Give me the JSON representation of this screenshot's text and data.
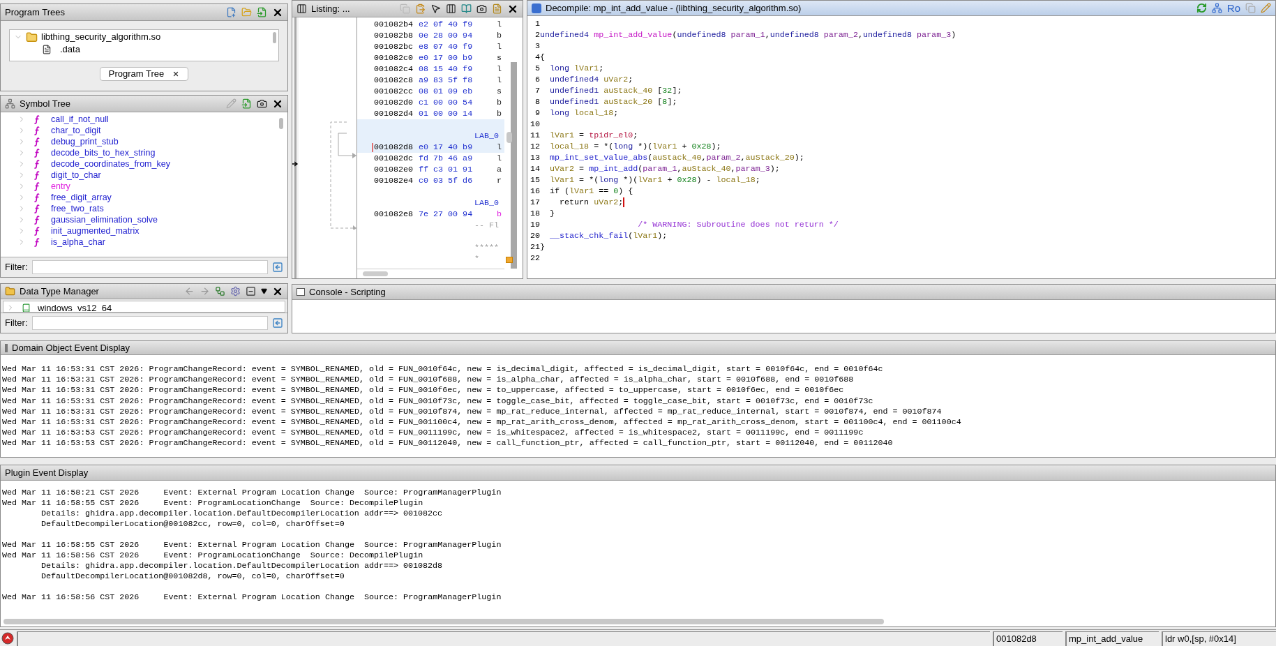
{
  "program_trees": {
    "title": "Program Trees",
    "root": {
      "label": "libthing_security_algorithm.so",
      "expanded": true,
      "children": [
        {
          "label": ".data"
        }
      ]
    },
    "tab": {
      "label": "Program Tree"
    }
  },
  "symbol_tree": {
    "title": "Symbol Tree",
    "items": [
      {
        "label": "call_if_not_null",
        "expanded": false,
        "color": "#2020d0"
      },
      {
        "label": "char_to_digit",
        "expanded": false,
        "color": "#2020d0"
      },
      {
        "label": "debug_print_stub",
        "expanded": false,
        "color": "#2020d0"
      },
      {
        "label": "decode_bits_to_hex_string",
        "expanded": false,
        "color": "#2020d0"
      },
      {
        "label": "decode_coordinates_from_key",
        "expanded": false,
        "color": "#2020d0"
      },
      {
        "label": "digit_to_char",
        "expanded": false,
        "color": "#2020d0"
      },
      {
        "label": "entry",
        "expanded": false,
        "color": "#e020e0"
      },
      {
        "label": "free_digit_array",
        "expanded": false,
        "color": "#2020d0"
      },
      {
        "label": "free_two_rats",
        "expanded": false,
        "color": "#2020d0"
      },
      {
        "label": "gaussian_elimination_solve",
        "expanded": false,
        "color": "#2020d0"
      },
      {
        "label": "init_augmented_matrix",
        "expanded": false,
        "color": "#2020d0"
      },
      {
        "label": "is_alpha_char",
        "expanded": false,
        "color": "#2020d0"
      }
    ],
    "filter_label": "Filter:"
  },
  "data_type_manager": {
    "title": "Data Type Manager",
    "items": [
      {
        "label": "windows_vs12_64",
        "expanded": false
      }
    ],
    "filter_label": "Filter:"
  },
  "listing": {
    "title": "Listing: ...",
    "rows": [
      {
        "kind": "code",
        "address": "001082b4",
        "bytes": "e2 0f 40 f9",
        "mnemonic": "l",
        "is_call": false,
        "highlighted": false,
        "cursor": false
      },
      {
        "kind": "code",
        "address": "001082b8",
        "bytes": "0e 28 00 94",
        "mnemonic": "b",
        "is_call": false,
        "highlighted": false,
        "cursor": false
      },
      {
        "kind": "code",
        "address": "001082bc",
        "bytes": "e8 07 40 f9",
        "mnemonic": "l",
        "is_call": false,
        "highlighted": false,
        "cursor": false
      },
      {
        "kind": "code",
        "address": "001082c0",
        "bytes": "e0 17 00 b9",
        "mnemonic": "s",
        "is_call": false,
        "highlighted": false,
        "cursor": false
      },
      {
        "kind": "code",
        "address": "001082c4",
        "bytes": "08 15 40 f9",
        "mnemonic": "l",
        "is_call": false,
        "highlighted": false,
        "cursor": false
      },
      {
        "kind": "code",
        "address": "001082c8",
        "bytes": "a9 83 5f f8",
        "mnemonic": "l",
        "is_call": false,
        "highlighted": false,
        "cursor": false
      },
      {
        "kind": "code",
        "address": "001082cc",
        "bytes": "08 01 09 eb",
        "mnemonic": "s",
        "is_call": false,
        "highlighted": false,
        "cursor": false
      },
      {
        "kind": "code",
        "address": "001082d0",
        "bytes": "c1 00 00 54",
        "mnemonic": "b",
        "is_call": false,
        "highlighted": false,
        "cursor": false
      },
      {
        "kind": "code",
        "address": "001082d4",
        "bytes": "01 00 00 14",
        "mnemonic": "b",
        "is_call": false,
        "highlighted": false,
        "cursor": false
      },
      {
        "kind": "spacer",
        "highlighted": true
      },
      {
        "kind": "label",
        "text": "LAB_0",
        "highlighted": true
      },
      {
        "kind": "code",
        "address": "001082d8",
        "bytes": "e0 17 40 b9",
        "mnemonic": "l",
        "is_call": false,
        "highlighted": true,
        "cursor": true
      },
      {
        "kind": "code",
        "address": "001082dc",
        "bytes": "fd 7b 46 a9",
        "mnemonic": "l",
        "is_call": false,
        "highlighted": false,
        "cursor": false
      },
      {
        "kind": "code",
        "address": "001082e0",
        "bytes": "ff c3 01 91",
        "mnemonic": "a",
        "is_call": false,
        "highlighted": false,
        "cursor": false
      },
      {
        "kind": "code",
        "address": "001082e4",
        "bytes": "c0 03 5f d6",
        "mnemonic": "r",
        "is_call": false,
        "highlighted": false,
        "cursor": false
      },
      {
        "kind": "spacer",
        "highlighted": false
      },
      {
        "kind": "label",
        "text": "LAB_0",
        "highlighted": false
      },
      {
        "kind": "code",
        "address": "001082e8",
        "bytes": "7e 27 00 94",
        "mnemonic": "b",
        "is_call": true,
        "highlighted": false,
        "cursor": false
      },
      {
        "kind": "comment",
        "text": "-- Fl",
        "highlighted": false
      },
      {
        "kind": "spacer",
        "highlighted": false
      },
      {
        "kind": "comment",
        "text": "*****",
        "highlighted": false
      },
      {
        "kind": "comment",
        "text": "*",
        "highlighted": false
      }
    ]
  },
  "decompile": {
    "title": "Decompile: mp_int_add_value -  (libthing_security_algorithm.so)",
    "ro": "Ro",
    "lines": [
      {
        "n": "1",
        "cursor": false
      },
      {
        "n": "2",
        "cursor": false,
        "segs": [
          {
            "t": "undefined4",
            "kind": "type"
          },
          {
            "t": " mp_int_add_value",
            "kind": "funcname"
          },
          {
            "t": "(",
            "kind": "plain"
          },
          {
            "t": "undefined8",
            "kind": "type"
          },
          {
            "t": " param_1",
            "kind": "param"
          },
          {
            "t": ",",
            "kind": "plain"
          },
          {
            "t": "undefined8",
            "kind": "type"
          },
          {
            "t": " param_2",
            "kind": "param"
          },
          {
            "t": ",",
            "kind": "plain"
          },
          {
            "t": "undefined8",
            "kind": "type"
          },
          {
            "t": " param_3",
            "kind": "param"
          },
          {
            "t": ")",
            "kind": "plain"
          }
        ]
      },
      {
        "n": "3",
        "cursor": false
      },
      {
        "n": "4",
        "cursor": false,
        "segs": [
          {
            "t": "{",
            "kind": "plain"
          }
        ]
      },
      {
        "n": "5",
        "cursor": false,
        "segs": [
          {
            "t": "  long",
            "kind": "type"
          },
          {
            "t": " lVar1",
            "kind": "var"
          },
          {
            "t": ";",
            "kind": "plain"
          }
        ]
      },
      {
        "n": "6",
        "cursor": false,
        "segs": [
          {
            "t": "  undefined4",
            "kind": "type"
          },
          {
            "t": " uVar2",
            "kind": "var"
          },
          {
            "t": ";",
            "kind": "plain"
          }
        ]
      },
      {
        "n": "7",
        "cursor": false,
        "segs": [
          {
            "t": "  undefined1",
            "kind": "type"
          },
          {
            "t": " auStack_40",
            "kind": "var"
          },
          {
            "t": " [",
            "kind": "plain"
          },
          {
            "t": "32",
            "kind": "const"
          },
          {
            "t": "];",
            "kind": "plain"
          }
        ]
      },
      {
        "n": "8",
        "cursor": false,
        "segs": [
          {
            "t": "  undefined1",
            "kind": "type"
          },
          {
            "t": " auStack_20",
            "kind": "var"
          },
          {
            "t": " [",
            "kind": "plain"
          },
          {
            "t": "8",
            "kind": "const"
          },
          {
            "t": "];",
            "kind": "plain"
          }
        ]
      },
      {
        "n": "9",
        "cursor": false,
        "segs": [
          {
            "t": "  long",
            "kind": "type"
          },
          {
            "t": " local_18",
            "kind": "var"
          },
          {
            "t": ";",
            "kind": "plain"
          }
        ]
      },
      {
        "n": "10",
        "cursor": false
      },
      {
        "n": "11",
        "cursor": false,
        "segs": [
          {
            "t": "  lVar1",
            "kind": "var"
          },
          {
            "t": " = ",
            "kind": "plain"
          },
          {
            "t": "tpidr_el0",
            "kind": "register"
          },
          {
            "t": ";",
            "kind": "plain"
          }
        ]
      },
      {
        "n": "12",
        "cursor": false,
        "segs": [
          {
            "t": "  local_18",
            "kind": "var"
          },
          {
            "t": " = *(",
            "kind": "plain"
          },
          {
            "t": "long",
            "kind": "type"
          },
          {
            "t": " *)(",
            "kind": "plain"
          },
          {
            "t": "lVar1",
            "kind": "var"
          },
          {
            "t": " + ",
            "kind": "plain"
          },
          {
            "t": "0x28",
            "kind": "const"
          },
          {
            "t": ");",
            "kind": "plain"
          }
        ]
      },
      {
        "n": "13",
        "cursor": false,
        "segs": [
          {
            "t": "  mp_int_set_value_abs",
            "kind": "call"
          },
          {
            "t": "(",
            "kind": "plain"
          },
          {
            "t": "auStack_40",
            "kind": "var"
          },
          {
            "t": ",",
            "kind": "plain"
          },
          {
            "t": "param_2",
            "kind": "param"
          },
          {
            "t": ",",
            "kind": "plain"
          },
          {
            "t": "auStack_20",
            "kind": "var"
          },
          {
            "t": ");",
            "kind": "plain"
          }
        ]
      },
      {
        "n": "14",
        "cursor": false,
        "segs": [
          {
            "t": "  uVar2",
            "kind": "var"
          },
          {
            "t": " = ",
            "kind": "plain"
          },
          {
            "t": "mp_int_add",
            "kind": "call"
          },
          {
            "t": "(",
            "kind": "plain"
          },
          {
            "t": "param_1",
            "kind": "param"
          },
          {
            "t": ",",
            "kind": "plain"
          },
          {
            "t": "auStack_40",
            "kind": "var"
          },
          {
            "t": ",",
            "kind": "plain"
          },
          {
            "t": "param_3",
            "kind": "param"
          },
          {
            "t": ");",
            "kind": "plain"
          }
        ]
      },
      {
        "n": "15",
        "cursor": false,
        "segs": [
          {
            "t": "  lVar1",
            "kind": "var"
          },
          {
            "t": " = *(",
            "kind": "plain"
          },
          {
            "t": "long",
            "kind": "type"
          },
          {
            "t": " *)(",
            "kind": "plain"
          },
          {
            "t": "lVar1",
            "kind": "var"
          },
          {
            "t": " + ",
            "kind": "plain"
          },
          {
            "t": "0x28",
            "kind": "const"
          },
          {
            "t": ") - ",
            "kind": "plain"
          },
          {
            "t": "local_18",
            "kind": "var"
          },
          {
            "t": ";",
            "kind": "plain"
          }
        ]
      },
      {
        "n": "16",
        "cursor": false,
        "segs": [
          {
            "t": "  if (",
            "kind": "plain"
          },
          {
            "t": "lVar1",
            "kind": "var"
          },
          {
            "t": " == ",
            "kind": "plain"
          },
          {
            "t": "0",
            "kind": "const"
          },
          {
            "t": ") {",
            "kind": "plain"
          }
        ]
      },
      {
        "n": "17",
        "cursor": true,
        "segs": [
          {
            "t": "    return ",
            "kind": "plain"
          },
          {
            "t": "uVar2",
            "kind": "var"
          },
          {
            "t": ";",
            "kind": "plain"
          }
        ]
      },
      {
        "n": "18",
        "cursor": false,
        "segs": [
          {
            "t": "  }",
            "kind": "plain"
          }
        ]
      },
      {
        "n": "19",
        "cursor": false,
        "segs": [
          {
            "t": "                    /* WARNING: Subroutine does not return */",
            "kind": "comment"
          }
        ]
      },
      {
        "n": "20",
        "cursor": false,
        "segs": [
          {
            "t": "  __stack_chk_fail",
            "kind": "call"
          },
          {
            "t": "(",
            "kind": "plain"
          },
          {
            "t": "lVar1",
            "kind": "var"
          },
          {
            "t": ");",
            "kind": "plain"
          }
        ]
      },
      {
        "n": "21",
        "cursor": false,
        "segs": [
          {
            "t": "}",
            "kind": "plain"
          }
        ]
      },
      {
        "n": "22",
        "cursor": false
      }
    ]
  },
  "console": {
    "title": "Console - Scripting"
  },
  "domain_events": {
    "title": "Domain Object Event Display",
    "lines": [
      "Wed Mar 11 16:53:31 CST 2026: ProgramChangeRecord: event = SYMBOL_RENAMED, old = FUN_0010f64c, new = is_decimal_digit, affected = is_decimal_digit, start = 0010f64c, end = 0010f64c",
      "Wed Mar 11 16:53:31 CST 2026: ProgramChangeRecord: event = SYMBOL_RENAMED, old = FUN_0010f688, new = is_alpha_char, affected = is_alpha_char, start = 0010f688, end = 0010f688",
      "Wed Mar 11 16:53:31 CST 2026: ProgramChangeRecord: event = SYMBOL_RENAMED, old = FUN_0010f6ec, new = to_uppercase, affected = to_uppercase, start = 0010f6ec, end = 0010f6ec",
      "Wed Mar 11 16:53:31 CST 2026: ProgramChangeRecord: event = SYMBOL_RENAMED, old = FUN_0010f73c, new = toggle_case_bit, affected = toggle_case_bit, start = 0010f73c, end = 0010f73c",
      "Wed Mar 11 16:53:31 CST 2026: ProgramChangeRecord: event = SYMBOL_RENAMED, old = FUN_0010f874, new = mp_rat_reduce_internal, affected = mp_rat_reduce_internal, start = 0010f874, end = 0010f874",
      "Wed Mar 11 16:53:31 CST 2026: ProgramChangeRecord: event = SYMBOL_RENAMED, old = FUN_001100c4, new = mp_rat_arith_cross_denom, affected = mp_rat_arith_cross_denom, start = 001100c4, end = 001100c4",
      "Wed Mar 11 16:53:53 CST 2026: ProgramChangeRecord: event = SYMBOL_RENAMED, old = FUN_0011199c, new = is_whitespace2, affected = is_whitespace2, start = 0011199c, end = 0011199c",
      "Wed Mar 11 16:53:53 CST 2026: ProgramChangeRecord: event = SYMBOL_RENAMED, old = FUN_00112040, new = call_function_ptr, affected = call_function_ptr, start = 00112040, end = 00112040"
    ]
  },
  "plugin_events": {
    "title": "Plugin Event Display",
    "groups": [
      {
        "events": [
          {
            "text": "Wed Mar 11 16:58:21 CST 2026     Event: External Program Location Change  Source: ProgramManagerPlugin"
          },
          {
            "text": "Wed Mar 11 16:58:55 CST 2026     Event: ProgramLocationChange  Source: DecompilePlugin",
            "details": [
              "Details: ghidra.app.decompiler.location.DefaultDecompilerLocation addr==> 001082cc",
              "DefaultDecompilerLocation@001082cc, row=0, col=0, charOffset=0"
            ]
          }
        ]
      },
      {
        "events": [
          {
            "text": "Wed Mar 11 16:58:55 CST 2026     Event: External Program Location Change  Source: ProgramManagerPlugin"
          },
          {
            "text": "Wed Mar 11 16:58:56 CST 2026     Event: ProgramLocationChange  Source: DecompilePlugin",
            "details": [
              "Details: ghidra.app.decompiler.location.DefaultDecompilerLocation addr==> 001082d8",
              "DefaultDecompilerLocation@001082d8, row=0, col=0, charOffset=0"
            ]
          }
        ]
      },
      {
        "events": [
          {
            "text": "Wed Mar 11 16:58:56 CST 2026     Event: External Program Location Change  Source: ProgramManagerPlugin"
          }
        ]
      }
    ]
  },
  "status_bar": {
    "address": "001082d8",
    "function": "mp_int_add_value",
    "instruction": "ldr w0,[sp, #0x14]"
  }
}
